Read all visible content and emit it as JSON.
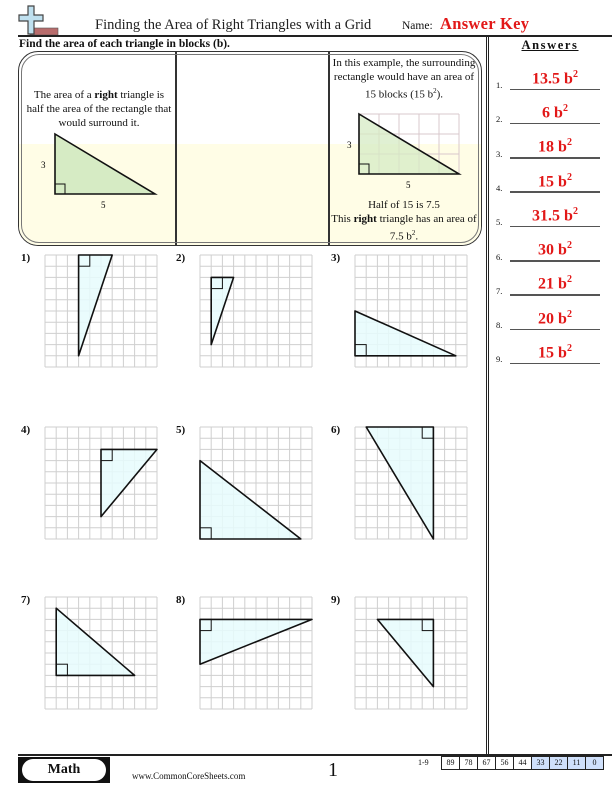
{
  "header": {
    "logo_icon": "plus-block-logo-icon",
    "title": "Finding the Area of Right Triangles with a Grid",
    "name_label": "Name:",
    "name_value": "Answer Key"
  },
  "instruction": "Find the area of each triangle in blocks (b).",
  "example": {
    "left_text": {
      "pre": "The area of a ",
      "bold": "right",
      "post": " triangle is half the area of the rectangle that would surround it."
    },
    "left_triangle": {
      "height_label": "3",
      "width_label": "5"
    },
    "right_text_top": {
      "main": "In this example, the surrounding rectangle would have an area of 15 blocks (15 b",
      "sup": "2",
      "end": ")."
    },
    "right_triangle": {
      "height_label": "3",
      "width_label": "5",
      "grid_cols": 5,
      "grid_rows": 3
    },
    "right_text_bottom": {
      "line1": "Half of 15 is 7.5",
      "pre": "This ",
      "bold": "right",
      "post": " triangle has an area of 7.5 b",
      "sup": "2",
      "end": "."
    }
  },
  "problems": [
    {
      "label": "1)",
      "grid": 10,
      "right_angle": [
        3,
        0
      ],
      "width": 3,
      "height": 9,
      "h_dir": "right",
      "v_dir": "down"
    },
    {
      "label": "2)",
      "grid": 10,
      "right_angle": [
        1,
        2
      ],
      "width": 2,
      "height": 6,
      "h_dir": "right",
      "v_dir": "down"
    },
    {
      "label": "3)",
      "grid": 10,
      "right_angle": [
        0,
        9
      ],
      "width": 9,
      "height": 4,
      "h_dir": "right",
      "v_dir": "up"
    },
    {
      "label": "4)",
      "grid": 10,
      "right_angle": [
        5,
        2
      ],
      "width": 5,
      "height": 6,
      "h_dir": "right",
      "v_dir": "down"
    },
    {
      "label": "5)",
      "grid": 10,
      "right_angle": [
        0,
        10
      ],
      "width": 9,
      "height": 7,
      "h_dir": "right",
      "v_dir": "up"
    },
    {
      "label": "6)",
      "grid": 10,
      "right_angle": [
        7,
        0
      ],
      "width": 6,
      "height": 10,
      "h_dir": "left",
      "v_dir": "down"
    },
    {
      "label": "7)",
      "grid": 10,
      "right_angle": [
        1,
        7
      ],
      "width": 7,
      "height": 6,
      "h_dir": "right",
      "v_dir": "up"
    },
    {
      "label": "8)",
      "grid": 10,
      "right_angle": [
        0,
        2
      ],
      "width": 10,
      "height": 4,
      "h_dir": "right",
      "v_dir": "down"
    },
    {
      "label": "9)",
      "grid": 10,
      "right_angle": [
        7,
        2
      ],
      "width": 5,
      "height": 6,
      "h_dir": "left",
      "v_dir": "down"
    }
  ],
  "answers": {
    "title": "Answers",
    "items": [
      {
        "num": "1.",
        "value": "13.5 b",
        "sup": "2"
      },
      {
        "num": "2.",
        "value": "6 b",
        "sup": "2"
      },
      {
        "num": "3.",
        "value": "18 b",
        "sup": "2"
      },
      {
        "num": "4.",
        "value": "15 b",
        "sup": "2"
      },
      {
        "num": "5.",
        "value": "31.5 b",
        "sup": "2"
      },
      {
        "num": "6.",
        "value": "30 b",
        "sup": "2"
      },
      {
        "num": "7.",
        "value": "21 b",
        "sup": "2"
      },
      {
        "num": "8.",
        "value": "20 b",
        "sup": "2"
      },
      {
        "num": "9.",
        "value": "15 b",
        "sup": "2"
      }
    ]
  },
  "footer": {
    "badge": "Math",
    "site": "www.CommonCoreSheets.com",
    "page": "1",
    "score_label": "1-9",
    "scores": [
      "89",
      "78",
      "67",
      "56",
      "44",
      "33",
      "22",
      "11",
      "0"
    ],
    "highlighted_from_index": 5
  },
  "colors": {
    "answer_red": "#e21818",
    "triangle_fill": "#e6fbfd",
    "example_fill": "#d6ebc4",
    "example_bg": "#fffde6",
    "grid_line": "#cfcfcf",
    "score_highlight": "#cfe0fb"
  }
}
